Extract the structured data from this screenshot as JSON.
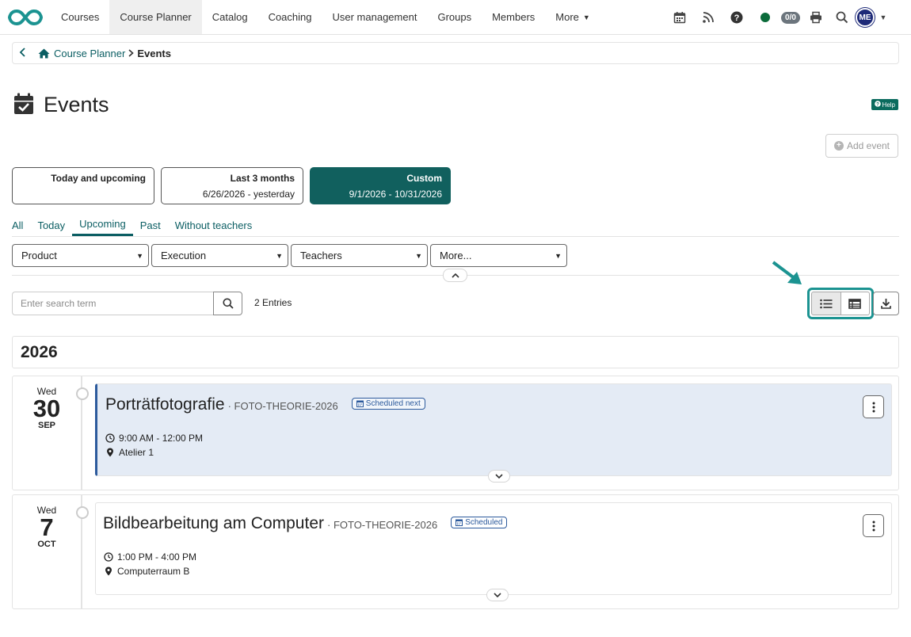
{
  "nav": {
    "items": [
      {
        "label": "Courses",
        "active": false
      },
      {
        "label": "Course Planner",
        "active": true
      },
      {
        "label": "Catalog",
        "active": false
      },
      {
        "label": "Coaching",
        "active": false
      },
      {
        "label": "User management",
        "active": false
      },
      {
        "label": "Groups",
        "active": false
      },
      {
        "label": "Members",
        "active": false
      },
      {
        "label": "More",
        "active": false
      }
    ],
    "counter": "0/0",
    "avatar_initials": "ME",
    "icons": [
      "calendar-icon",
      "rss-icon",
      "help-circle-icon",
      "online-status-dot",
      "print-icon",
      "search-icon"
    ]
  },
  "breadcrumb": {
    "parent": "Course Planner",
    "current": "Events"
  },
  "page": {
    "title": "Events",
    "help_label": "Help",
    "add_event_label": "Add event"
  },
  "presets": [
    {
      "label": "Today and upcoming",
      "range": "",
      "active": false
    },
    {
      "label": "Last 3 months",
      "range": "6/26/2026 - yesterday",
      "active": false
    },
    {
      "label": "Custom",
      "range": "9/1/2026 - 10/31/2026",
      "active": true
    }
  ],
  "tabs": [
    {
      "label": "All",
      "active": false
    },
    {
      "label": "Today",
      "active": false
    },
    {
      "label": "Upcoming",
      "active": true
    },
    {
      "label": "Past",
      "active": false
    },
    {
      "label": "Without teachers",
      "active": false
    }
  ],
  "filters": [
    "Product",
    "Execution",
    "Teachers",
    "More..."
  ],
  "search": {
    "placeholder": "Enter search term",
    "entries": "2 Entries"
  },
  "year": "2026",
  "events": [
    {
      "dow": "Wed",
      "day": "30",
      "month": "SEP",
      "title": "Porträtfotografie",
      "code": "· FOTO-THEORIE-2026",
      "status": "Scheduled next",
      "time": "9:00 AM - 12:00 PM",
      "location": "Atelier 1",
      "highlighted": true
    },
    {
      "dow": "Wed",
      "day": "7",
      "month": "OCT",
      "title": "Bildbearbeitung am Computer",
      "code": "· FOTO-THEORIE-2026",
      "status": "Scheduled",
      "time": "1:00 PM - 4:00 PM",
      "location": "Computerraum B",
      "highlighted": false
    }
  ],
  "colors": {
    "brand": "#11605e",
    "link": "#0b5e63",
    "highlight_accent": "#2c5a9c",
    "annotation": "#1b9391"
  }
}
